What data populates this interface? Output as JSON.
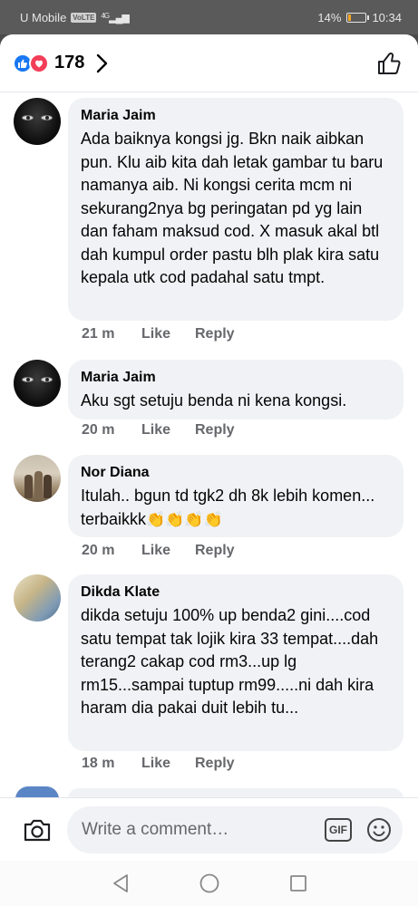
{
  "status_bar": {
    "carrier": "U Mobile",
    "network_badge": "VoLTE",
    "network_type": "4G",
    "battery_percent": "14%",
    "battery_level": 0.14,
    "battery_color": "#f5a623",
    "time": "10:34"
  },
  "reactions": {
    "count": "178",
    "icons": [
      "like-reaction-icon",
      "love-reaction-icon"
    ],
    "like_color": "#1877f2",
    "love_color": "#f33e58"
  },
  "comments": [
    {
      "author": "Maria Jaim",
      "text": "Ada baiknya kongsi jg. Bkn naik aibkan pun. Klu aib kita dah letak gambar tu baru namanya aib. Ni kongsi cerita mcm ni sekurang2nya bg peringatan pd yg lain dan faham maksud cod. X masuk akal btl dah kumpul order pastu blh plak kira satu kepala utk cod padahal satu tmpt.",
      "time": "21 m",
      "like_label": "Like",
      "reply_label": "Reply"
    },
    {
      "author": "Maria Jaim",
      "text": "Aku sgt setuju benda ni kena kongsi.",
      "time": "20 m",
      "like_label": "Like",
      "reply_label": "Reply"
    },
    {
      "author": "Nor Diana",
      "text": "Itulah.. bgun td tgk2 dh 8k lebih komen... terbaikkk",
      "emoji": "👏👏👏👏",
      "time": "20 m",
      "like_label": "Like",
      "reply_label": "Reply"
    },
    {
      "author": "Dikda Klate",
      "text": "dikda setuju 100% up benda2 gini....cod satu tempat tak lojik kira 33 tempat....dah terang2 cakap cod rm3...up lg rm15...sampai tuptup rm99.....ni dah kira haram dia pakai duit lebih tu...",
      "time": "18 m",
      "like_label": "Like",
      "reply_label": "Reply"
    }
  ],
  "composer": {
    "placeholder": "Write a comment…",
    "gif_label": "GIF"
  },
  "accent_color": "#1877f2"
}
